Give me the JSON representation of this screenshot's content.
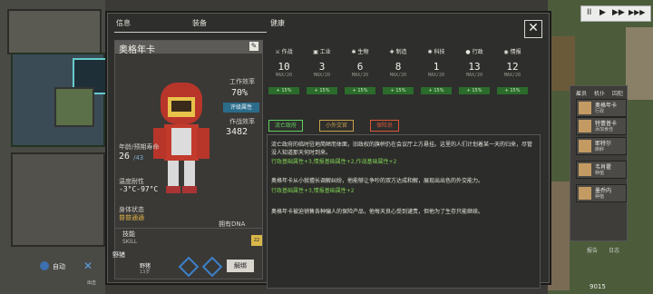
{
  "tabs": {
    "info": "信息",
    "equipment": "装备",
    "health": "健康",
    "close": "✕"
  },
  "character": {
    "name": "奥格年卡",
    "work_eff_label": "工作效率",
    "work_eff_value": "70%",
    "eval_button": "评级属性",
    "op_eff_label": "作战效率",
    "op_eff_value": "3482",
    "age_label": "年龄/预期寿命",
    "age_value": "26",
    "age_max": "/43",
    "temp_label": "温度耐性",
    "temp_value": "-3°C-97°C",
    "status_label": "身体状态",
    "status_value": "普普通通",
    "dna": "拥有DNA",
    "skills_label": "技能",
    "skills_en": "SKILL",
    "skill_icon": "zz"
  },
  "attributes": [
    {
      "label": "作战",
      "icon": "sword-icon",
      "value": "10",
      "max": "MAX/20",
      "bonus": "+ 15%"
    },
    {
      "label": "工业",
      "icon": "factory-icon",
      "value": "3",
      "max": "MAX/20",
      "bonus": "+ 15%"
    },
    {
      "label": "生物",
      "icon": "paw-icon",
      "value": "6",
      "max": "MAX/20",
      "bonus": "+ 15%"
    },
    {
      "label": "制造",
      "icon": "tools-icon",
      "value": "8",
      "max": "MAX/20",
      "bonus": "+ 15%"
    },
    {
      "label": "科技",
      "icon": "atom-icon",
      "value": "1",
      "max": "MAX/20",
      "bonus": "+ 15%"
    },
    {
      "label": "行政",
      "icon": "bulb-icon",
      "value": "13",
      "max": "MAX/20",
      "bonus": "+ 15%"
    },
    {
      "label": "情报",
      "icon": "eye-icon",
      "value": "12",
      "max": "MAX/20",
      "bonus": "+ 15%"
    }
  ],
  "traits": [
    {
      "label": "流亡政府",
      "color": "#5fd05f"
    },
    {
      "label": "小外交官",
      "color": "#c8a24b"
    },
    {
      "label": "保险员",
      "color": "#d9563b"
    }
  ],
  "description": {
    "p1": "流亡政府的临时驻地简陋而体面，旧政权的旗帜仍在会议厅上方悬挂。这里的人们计划着某一天的归来，尽管没人知道那天何时到来。",
    "p1_green": "行政基础属性+3,情报基础属性+2,作战基础属性+2",
    "p2": "奥格年卡从小就擅长调解纠纷，他能够让争吵的双方达成和解，展现出出色的外交能力。",
    "p2_green": "行政基础属性+3,情报基础属性+2",
    "p3": "奥格年卡被迫销售各种骗人的保险产品，他每天良心受到谴责，但他为了生存只能继续。"
  },
  "crew_panel": {
    "tab1": "雇员",
    "tab2": "机仆",
    "tab3": "囚犯",
    "items": [
      {
        "name": "奥格年卡",
        "role": "行政"
      },
      {
        "name": "特蕾普卡",
        "role": "添加食佳"
      },
      {
        "name": "耶特尔",
        "role": "麻醉"
      },
      {
        "name": "韦肖霍",
        "role": "种植"
      },
      {
        "name": "墨乔内",
        "role": "种植"
      }
    ]
  },
  "bottom": {
    "auto_label": "自动",
    "pet_label": "野猪",
    "pet_name": "野猪",
    "pet_age": "13岁",
    "release_button": "解绑",
    "menu_label": "出击",
    "right_bottom_1": "报告",
    "right_bottom_2": "日志",
    "coord": "9015"
  },
  "topbar": {
    "pause": "II",
    "play": "▶",
    "ff": "▶▶",
    "fff": "▶▶▶"
  }
}
